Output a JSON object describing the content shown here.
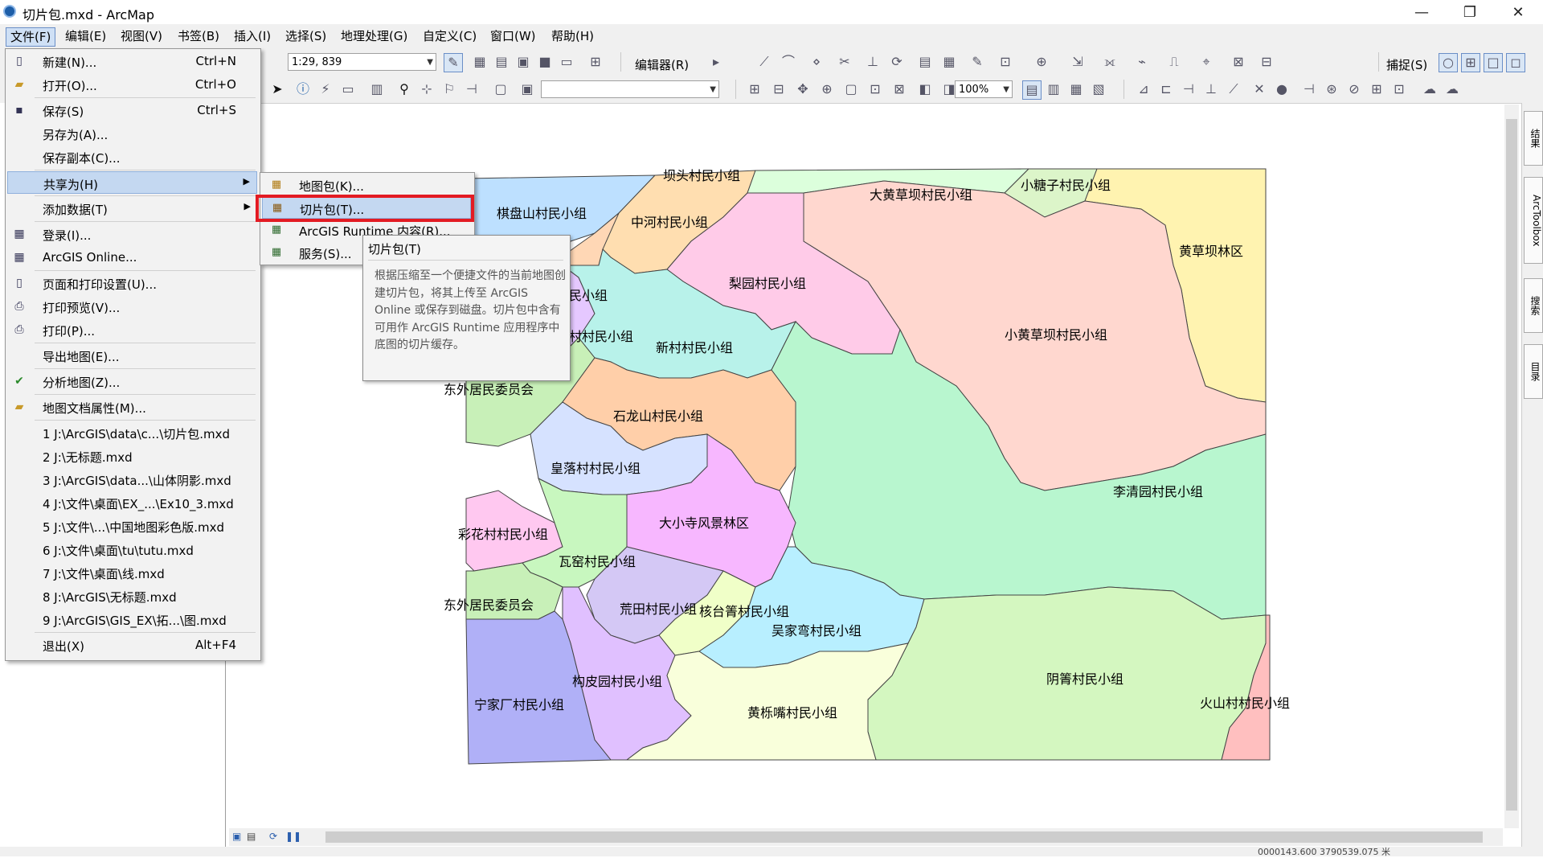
{
  "window": {
    "title": "切片包.mxd - ArcMap",
    "minimize": "—",
    "maximize": "❐",
    "close": "✕"
  },
  "menubar": [
    "文件(F)",
    "编辑(E)",
    "视图(V)",
    "书签(B)",
    "插入(I)",
    "选择(S)",
    "地理处理(G)",
    "自定义(C)",
    "窗口(W)",
    "帮助(H)"
  ],
  "toolbar": {
    "scale": "1:29, 839",
    "editor_label": "编辑器(R)",
    "snapping_label": "捕捉(S)",
    "zoom_percent": "100%"
  },
  "file_menu": {
    "items": [
      {
        "label": "新建(N)...",
        "shortcut": "Ctrl+N",
        "icon": "new-document-icon"
      },
      {
        "label": "打开(O)...",
        "shortcut": "Ctrl+O",
        "icon": "open-folder-icon"
      },
      {
        "label": "保存(S)",
        "shortcut": "Ctrl+S",
        "icon": "save-icon"
      },
      {
        "label": "另存为(A)...",
        "shortcut": "",
        "icon": ""
      },
      {
        "label": "保存副本(C)...",
        "shortcut": "",
        "icon": ""
      },
      {
        "label": "共享为(H)",
        "shortcut": "",
        "icon": "",
        "submenu": true
      },
      {
        "label": "添加数据(T)",
        "shortcut": "",
        "icon": "",
        "submenu": true
      },
      {
        "label": "登录(I)...",
        "shortcut": "",
        "icon": "sign-in-icon"
      },
      {
        "label": "ArcGIS Online...",
        "shortcut": "",
        "icon": "arcgis-online-icon"
      },
      {
        "label": "页面和打印设置(U)...",
        "shortcut": "",
        "icon": "page-setup-icon"
      },
      {
        "label": "打印预览(V)...",
        "shortcut": "",
        "icon": "print-preview-icon"
      },
      {
        "label": "打印(P)...",
        "shortcut": "",
        "icon": "print-icon"
      },
      {
        "label": "导出地图(E)...",
        "shortcut": "",
        "icon": ""
      },
      {
        "label": "分析地图(Z)...",
        "shortcut": "",
        "icon": "analyze-map-icon"
      },
      {
        "label": "地图文档属性(M)...",
        "shortcut": "",
        "icon": "document-properties-icon"
      },
      {
        "label": "1 J:\\ArcGIS\\data\\c...\\切片包.mxd",
        "shortcut": "",
        "icon": ""
      },
      {
        "label": "2 J:\\无标题.mxd",
        "shortcut": "",
        "icon": ""
      },
      {
        "label": "3 J:\\ArcGIS\\data...\\山体阴影.mxd",
        "shortcut": "",
        "icon": ""
      },
      {
        "label": "4 J:\\文件\\桌面\\EX_...\\Ex10_3.mxd",
        "shortcut": "",
        "icon": ""
      },
      {
        "label": "5 J:\\文件\\...\\中国地图彩色版.mxd",
        "shortcut": "",
        "icon": ""
      },
      {
        "label": "6 J:\\文件\\桌面\\tu\\tutu.mxd",
        "shortcut": "",
        "icon": ""
      },
      {
        "label": "7 J:\\文件\\桌面\\线.mxd",
        "shortcut": "",
        "icon": ""
      },
      {
        "label": "8 J:\\ArcGIS\\无标题.mxd",
        "shortcut": "",
        "icon": ""
      },
      {
        "label": "9 J:\\ArcGIS\\GIS_EX\\拓...\\图.mxd",
        "shortcut": "",
        "icon": ""
      },
      {
        "label": "退出(X)",
        "shortcut": "Alt+F4",
        "icon": ""
      }
    ]
  },
  "share_submenu": {
    "items": [
      {
        "label": "地图包(K)...",
        "icon": "map-package-icon"
      },
      {
        "label": "切片包(T)...",
        "icon": "tile-package-icon"
      },
      {
        "label": "ArcGIS Runtime 内容(R)...",
        "icon": "runtime-content-icon"
      },
      {
        "label": "服务(S)...",
        "icon": "service-icon"
      }
    ]
  },
  "tooltip": {
    "title": "切片包(T)",
    "body": "根据压缩至一个便捷文件的当前地图创建切片包，将其上传至 ArcGIS Online 或保存到磁盘。切片包中含有可用作 ArcGIS Runtime 应用程序中底图的切片缓存。"
  },
  "map_labels": [
    "坝头村民小组",
    "棋盘山村民小组",
    "中河村民小组",
    "大黄草坝村民小组",
    "小糖子村民小组",
    "黄草坝林区",
    "梨园村民小组",
    "民小组",
    "村村民小组",
    "新村村民小组",
    "小黄草坝村民小组",
    "东外居民委员会",
    "石龙山村民小组",
    "皇落村村民小组",
    "李清园村民小组",
    "大小寺风景林区",
    "彩花村村民小组",
    "瓦窑村民小组",
    "东外居民委员会",
    "荒田村民小组",
    "核台箐村民小组",
    "吴家弯村民小组",
    "阴箐村民小组",
    "构皮园村民小组",
    "宁家厂村民小组",
    "黄栎嘴村民小组",
    "火山村村民小组"
  ],
  "right_tabs": [
    "结果",
    "ArcToolbox",
    "搜索",
    "目录"
  ],
  "status": {
    "coords": "0000143.600  3790539.075 米"
  }
}
